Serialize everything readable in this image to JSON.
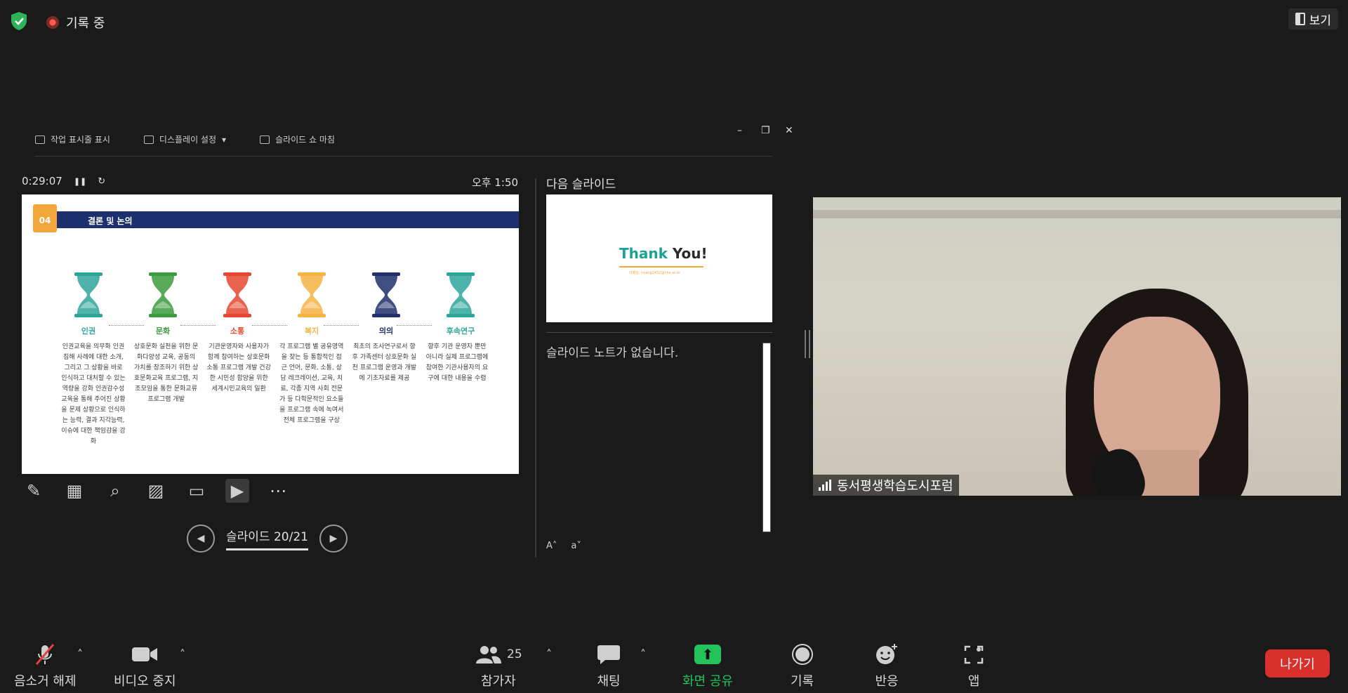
{
  "top_bar": {
    "recording_label": "기록 중",
    "view_label": "보기"
  },
  "presenter": {
    "toolbar": {
      "taskbar_label": "작업 표시줄 표시",
      "display_settings_label": "디스플레이 설정",
      "end_show_label": "슬라이드 쇼 마침"
    },
    "timer": "0:29:07",
    "clock": "오후 1:50",
    "next_slide_label": "다음 슬라이드",
    "notes_text": "슬라이드 노트가 없습니다.",
    "slide_counter": "슬라이드 20/21",
    "current_slide": {
      "badge_small": "PART",
      "badge_number": "04",
      "title": "결론 및 논의",
      "columns": [
        {
          "label": "인권",
          "color": "#2ea59a",
          "text": "인권교육을 의무화 인권 침해 사례에 대한 소개, 그리고 그 상황을 바로 인식하고 대처할 수 있는 역량을 강화 인권감수성 교육을 통해 주어진 상황을 문제 상황으로 인식하는 능력, 결과 지각능력, 이슈에 대한 책임감을 강화"
        },
        {
          "label": "문화",
          "color": "#3b9a3c",
          "text": "상호문화 실천을 위한 문화다양성 교육, 공동의 가치를 창조하기 위한 상호문화교육 프로그램, 지조모임을 통한 문화교류 프로그램 개발"
        },
        {
          "label": "소통",
          "color": "#e4472e",
          "text": "기관운영자와 사용자가 함께 참여하는 상호문화소통 프로그램 개발 건강한 시민성 함양을 위한 세계시민교육의 일환"
        },
        {
          "label": "복지",
          "color": "#f5b342",
          "text": "각 프로그램 별 공유영역을 찾는 등 통합적인 접근 언어, 문화, 소통, 상담 레크레이션, 교육, 치료, 각종 지역 사회 전문가 등 다학문적인 요소들을 프로그램 속에 녹여서 전체 프로그램을 구상"
        },
        {
          "label": "의의",
          "color": "#1e2f6b",
          "text": "최초의 조사연구로서 향후 가족센터 상호문화 실천 프로그램 운영과 개발에 기초자료를 제공"
        },
        {
          "label": "후속연구",
          "color": "#2ea59a",
          "text": "향후 기관 운영자 뿐만 아니라 실제 프로그램에 참여한 기관사용자의 요구에 대한 내용을 수렴"
        }
      ]
    },
    "next_slide": {
      "title_main": "Thank",
      "title_end": " You!",
      "subtitle": "이메일: hoang2432@nhs.ac.kr"
    }
  },
  "video": {
    "participant_name": "동서평생학습도시포럼"
  },
  "bottom_bar": {
    "mute_label": "음소거 해제",
    "video_label": "비디오 중지",
    "participants_label": "참가자",
    "participants_count": "25",
    "chat_label": "채팅",
    "share_label": "화면 공유",
    "record_label": "기록",
    "reactions_label": "반응",
    "apps_label": "앱",
    "leave_label": "나가기"
  },
  "colors": {
    "share_green": "#22c35b",
    "leave_red": "#d9302c",
    "slide_navy": "#1c2f6e",
    "slide_orange": "#f3a73b"
  }
}
